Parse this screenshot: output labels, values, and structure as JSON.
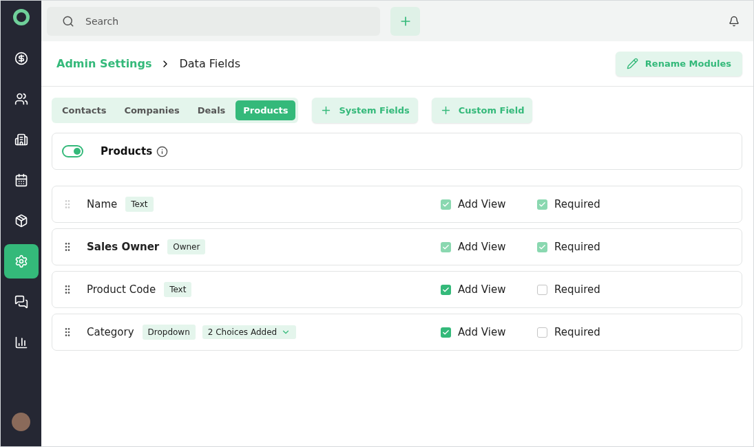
{
  "sidebar": {
    "items": [
      {
        "kind": "deals",
        "selected": false
      },
      {
        "kind": "contacts",
        "selected": false
      },
      {
        "kind": "companies",
        "selected": false
      },
      {
        "kind": "calendar",
        "selected": false
      },
      {
        "kind": "products",
        "selected": false
      },
      {
        "kind": "settings",
        "selected": true
      },
      {
        "kind": "chat",
        "selected": false
      },
      {
        "kind": "reports",
        "selected": false
      }
    ]
  },
  "topbar": {
    "search": {
      "placeholder": "Search"
    }
  },
  "breadcrumb": [
    "Admin Settings",
    "Data Fields"
  ],
  "rename_button": "Rename Modules",
  "tabs": [
    {
      "label": "Contacts",
      "selected": false
    },
    {
      "label": "Companies",
      "selected": false
    },
    {
      "label": "Deals",
      "selected": false
    },
    {
      "label": "Products",
      "selected": true
    }
  ],
  "actions": [
    "System Fields",
    "Custom Field"
  ],
  "module": {
    "label": "Products",
    "on": true
  },
  "fields": [
    {
      "name": "Name",
      "bold": false,
      "draggable": false,
      "tags": [
        {
          "label": "Text",
          "kind": "tag"
        }
      ],
      "add_view": {
        "label": "Add View",
        "checked": true,
        "disabled": true
      },
      "required": {
        "label": "Required",
        "checked": true,
        "disabled": true
      }
    },
    {
      "name": "Sales Owner",
      "bold": true,
      "draggable": true,
      "tags": [
        {
          "label": "Owner",
          "kind": "tag"
        }
      ],
      "add_view": {
        "label": "Add View",
        "checked": true,
        "disabled": true
      },
      "required": {
        "label": "Required",
        "checked": true,
        "disabled": true
      }
    },
    {
      "name": "Product Code",
      "bold": false,
      "draggable": true,
      "tags": [
        {
          "label": "Text",
          "kind": "tag"
        }
      ],
      "add_view": {
        "label": "Add View",
        "checked": true,
        "disabled": false
      },
      "required": {
        "label": "Required",
        "checked": false,
        "disabled": false
      }
    },
    {
      "name": "Category",
      "bold": false,
      "draggable": true,
      "tags": [
        {
          "label": "Dropdown",
          "kind": "tag"
        },
        {
          "label": "2 Choices Added",
          "kind": "dropdown"
        }
      ],
      "add_view": {
        "label": "Add View",
        "checked": true,
        "disabled": false
      },
      "required": {
        "label": "Required",
        "checked": false,
        "disabled": false
      }
    }
  ]
}
